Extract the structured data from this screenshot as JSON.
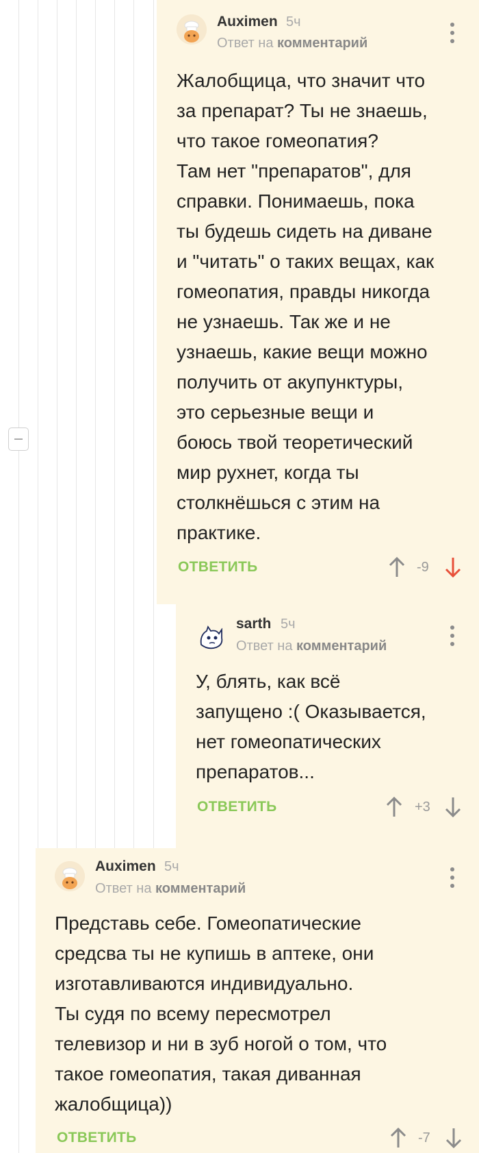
{
  "thread": {
    "collapse_label": "−"
  },
  "comments": [
    {
      "author": "Auximen",
      "time": "5ч",
      "reply_prefix": "Ответ на ",
      "reply_target": "комментарий",
      "text": "Жалобщица, что значит что\nза препарат? Ты не знаешь,\nчто такое гомеопатия?\nТам нет \"препаратов\", для\nсправки. Понимаешь, пока\nты будешь сидеть на диване\nи \"читать\" о таких вещах, как\nгомеопатия, правды никогда\nне узнаешь. Так же и не\nузнаешь, какие вещи можно\nполучить от акупунктуры,\nэто серьезные вещи и\nбоюсь твой теоретический\nмир рухнет, когда ты\nстолкнёшься с этим на\nпрактике.",
      "reply_label": "ОТВЕТИТЬ",
      "score": "-9",
      "avatar_icon": "chef-avatar-icon",
      "downvoted": true
    },
    {
      "author": "sarth",
      "time": "5ч",
      "reply_prefix": "Ответ на ",
      "reply_target": "комментарий",
      "text": "У, блять, как всё\nзапущено :( Оказывается,\nнет гомеопатических\nпрепаратов...",
      "reply_label": "ОТВЕТИТЬ",
      "score": "+3",
      "avatar_icon": "cat-sketch-avatar-icon",
      "downvoted": false
    },
    {
      "author": "Auximen",
      "time": "5ч",
      "reply_prefix": "Ответ на ",
      "reply_target": "комментарий",
      "text": "Представь себе. Гомеопатические\nсредсва ты не купишь в аптеке, они\nизготавливаются индивидуально.\nТы судя по всему пересмотрел\nтелевизор и ни в зуб ногой о том, что\nтакое гомеопатия, такая диванная\nжалобщица))",
      "reply_label": "ОТВЕТИТЬ",
      "score": "-7",
      "avatar_icon": "chef-avatar-icon",
      "downvoted": false
    }
  ],
  "colors": {
    "comment_bg": "#fdf6e3",
    "reply_green": "#8ac858",
    "downvote_red": "#e8503a",
    "muted": "#a9a9a9"
  }
}
